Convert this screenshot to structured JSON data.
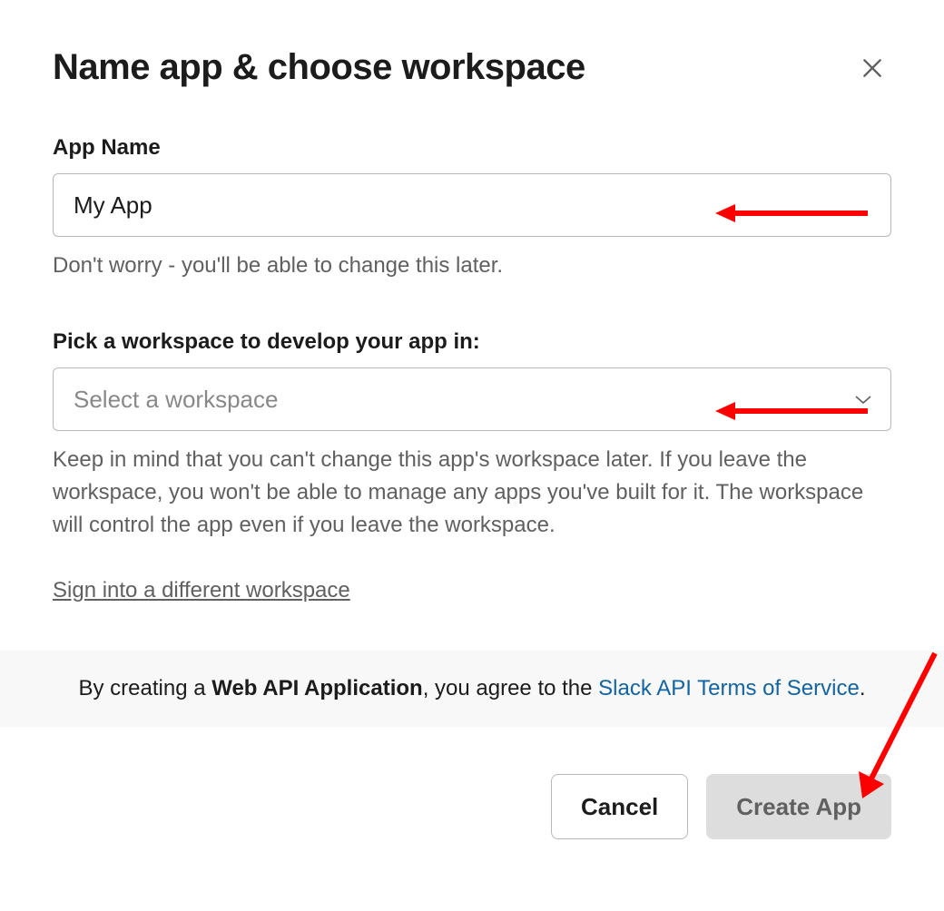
{
  "modal": {
    "title": "Name app & choose workspace"
  },
  "appName": {
    "label": "App Name",
    "value": "My App",
    "hint": "Don't worry - you'll be able to change this later."
  },
  "workspace": {
    "label": "Pick a workspace to develop your app in:",
    "placeholder": "Select a workspace",
    "hint": "Keep in mind that you can't change this app's workspace later. If you leave the workspace, you won't be able to manage any apps you've built for it. The workspace will control the app even if you leave the workspace.",
    "signin_link": "Sign into a different workspace"
  },
  "terms": {
    "prefix": "By creating a ",
    "bold": "Web API Application",
    "mid": ", you agree to the ",
    "link": "Slack API Terms of Service",
    "suffix": "."
  },
  "footer": {
    "cancel": "Cancel",
    "create": "Create App"
  },
  "annotations": {
    "arrow_color": "#ff0000"
  }
}
